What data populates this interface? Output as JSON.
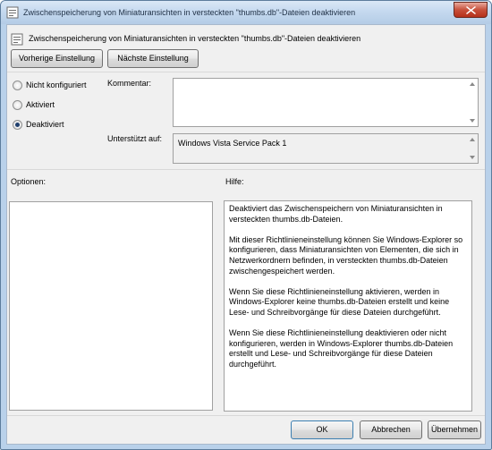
{
  "window": {
    "title": "Zwischenspeicherung von Miniaturansichten in versteckten \"thumbs.db\"-Dateien deaktivieren",
    "accent": "#b9d1ea"
  },
  "header": {
    "setting_name": "Zwischenspeicherung von Miniaturansichten in versteckten \"thumbs.db\"-Dateien deaktivieren",
    "icon": "policy-setting-icon"
  },
  "nav": {
    "previous_label": "Vorherige Einstellung",
    "next_label": "Nächste Einstellung"
  },
  "state": {
    "options": [
      {
        "label": "Nicht konfiguriert",
        "checked": false
      },
      {
        "label": "Aktiviert",
        "checked": false
      },
      {
        "label": "Deaktiviert",
        "checked": true
      }
    ]
  },
  "comment": {
    "label": "Kommentar:",
    "value": ""
  },
  "supported": {
    "label": "Unterstützt auf:",
    "value": "Windows Vista Service Pack 1"
  },
  "options_panel": {
    "label": "Optionen:"
  },
  "help_panel": {
    "label": "Hilfe:",
    "paragraphs": [
      "Deaktiviert das Zwischenspeichern von Miniaturansichten in versteckten thumbs.db-Dateien.",
      "Mit dieser Richtlinieneinstellung können Sie Windows-Explorer so konfigurieren, dass Miniaturansichten von Elementen, die sich in Netzwerkordnern befinden, in versteckten thumbs.db-Dateien zwischengespeichert werden.",
      "Wenn Sie diese Richtlinieneinstellung aktivieren, werden in Windows-Explorer keine thumbs.db-Dateien erstellt und keine Lese- und Schreibvorgänge für diese Dateien durchgeführt.",
      "Wenn Sie diese Richtlinieneinstellung deaktivieren oder nicht konfigurieren, werden in Windows-Explorer thumbs.db-Dateien erstellt und Lese- und Schreibvorgänge für diese Dateien durchgeführt."
    ]
  },
  "footer": {
    "ok_label": "OK",
    "cancel_label": "Abbrechen",
    "apply_label": "Übernehmen"
  }
}
